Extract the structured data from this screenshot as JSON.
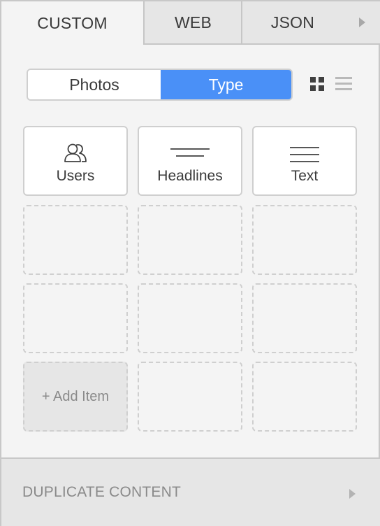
{
  "tabs": {
    "custom": "CUSTOM",
    "web": "WEB",
    "json": "JSON",
    "more_icon": "triangle-right-icon"
  },
  "segmented": {
    "photos": "Photos",
    "type": "Type",
    "selected": "Type",
    "accent_color": "#4a90f7"
  },
  "view_toggle": {
    "grid_icon": "grid-view-icon",
    "list_icon": "list-view-icon",
    "selected": "grid"
  },
  "items": [
    {
      "label": "Users",
      "icon": "users-icon"
    },
    {
      "label": "Headlines",
      "icon": "headlines-icon"
    },
    {
      "label": "Text",
      "icon": "text-lines-icon"
    }
  ],
  "add_item": "+ Add Item",
  "footer": {
    "label": "DUPLICATE CONTENT",
    "arrow_icon": "triangle-right-icon"
  }
}
